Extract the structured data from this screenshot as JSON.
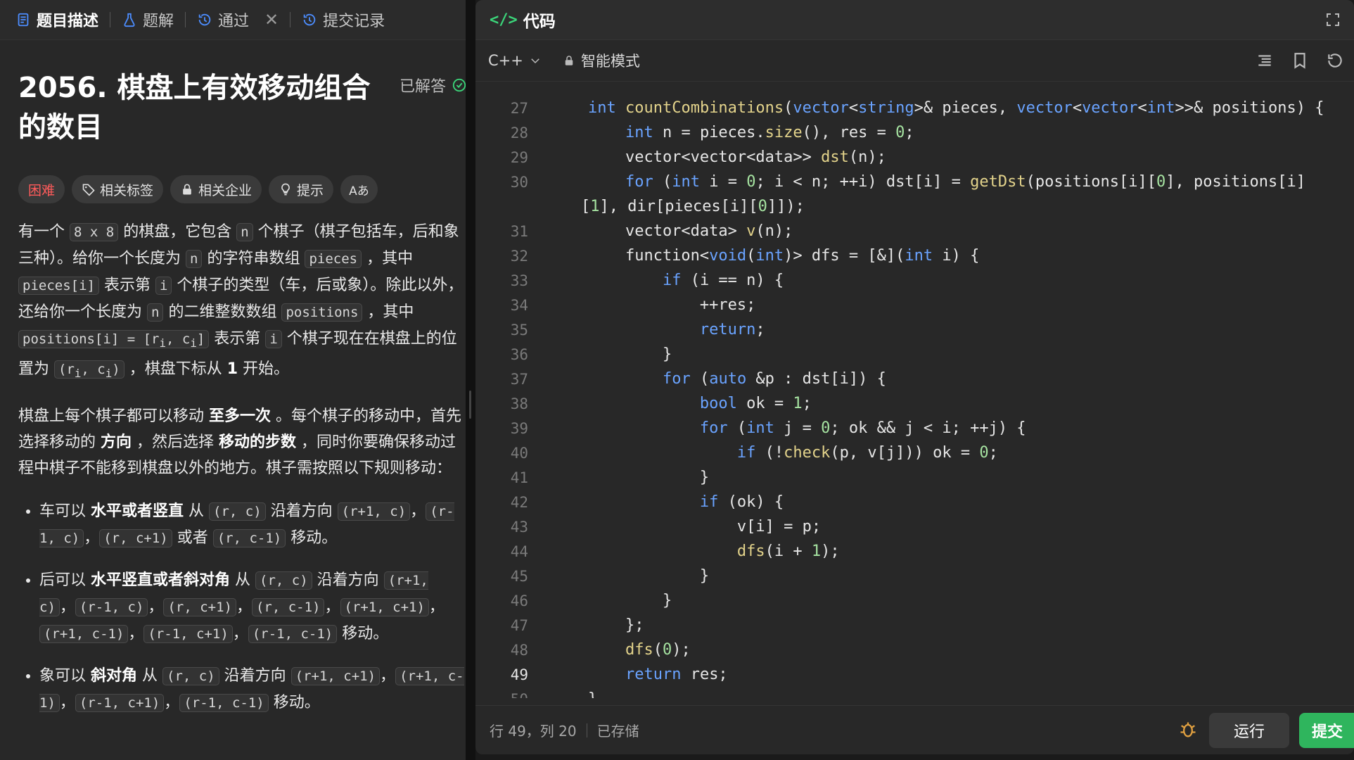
{
  "left_tabs": [
    {
      "label": "题目描述",
      "active": true
    },
    {
      "label": "题解",
      "active": false
    },
    {
      "label": "通过",
      "active": false
    },
    {
      "label": "提交记录",
      "active": false
    }
  ],
  "problem": {
    "title_line1": "2056. 棋盘上有效移动组合",
    "title_line2": "的数目",
    "solved_label": "已解答",
    "chips": {
      "difficulty": "困难",
      "tags": "相关标签",
      "companies": "相关企业",
      "hint": "提示",
      "font": "Aあ"
    }
  },
  "editor": {
    "header_title": "代码",
    "language": "C++",
    "mode": "智能模式",
    "status_position": "行 49，列 20",
    "status_saved": "已存储",
    "run_label": "运行",
    "submit_label": "提交",
    "current_line": 49,
    "accent_color": "#2fb55d"
  }
}
